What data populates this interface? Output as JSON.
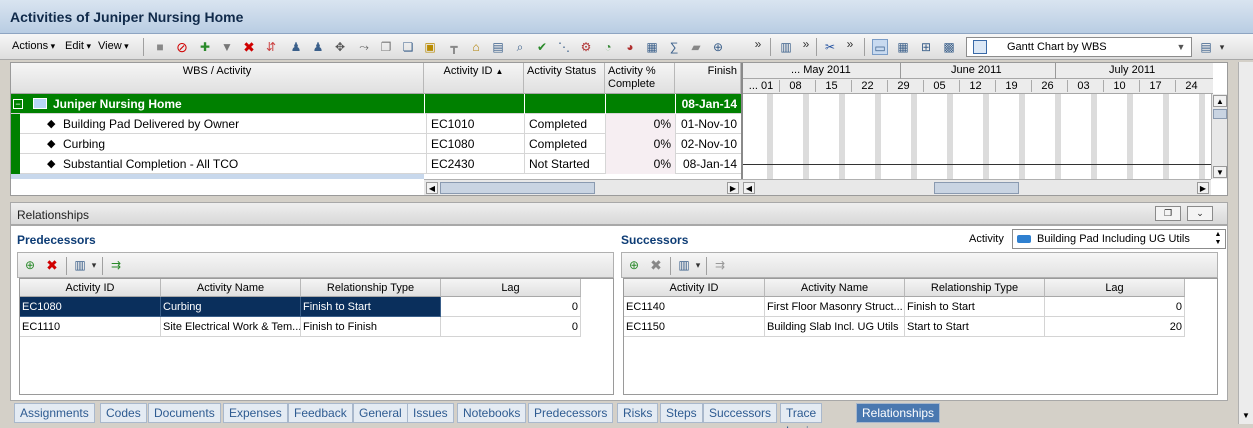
{
  "window": {
    "title": "Activities of Juniper Nursing Home"
  },
  "toolbar": {
    "menus": [
      "Actions",
      "Edit",
      "View"
    ],
    "layout_name": "Gantt Chart by WBS",
    "overflow": "»"
  },
  "grid": {
    "columns": [
      "WBS / Activity",
      "Activity ID",
      "Activity Status",
      "Activity % Complete",
      "Finish"
    ],
    "sort_indicator": "▲",
    "wbs_row": {
      "name": "Juniper Nursing Home",
      "finish": "08-Jan-14",
      "toggle": "−"
    },
    "rows": [
      {
        "name": "Building Pad Delivered by Owner",
        "id": "EC1010",
        "status": "Completed",
        "pct": "0%",
        "finish": "01-Nov-10"
      },
      {
        "name": "Curbing",
        "id": "EC1080",
        "status": "Completed",
        "pct": "0%",
        "finish": "02-Nov-10"
      },
      {
        "name": "Substantial Completion - All TCO",
        "id": "EC2430",
        "status": "Not Started",
        "pct": "0%",
        "finish": "08-Jan-14"
      }
    ]
  },
  "gantt": {
    "months": [
      "... May 2011",
      "June 2011",
      "July 2011"
    ],
    "days": [
      "... 01",
      "08",
      "15",
      "22",
      "29",
      "05",
      "12",
      "19",
      "26",
      "03",
      "10",
      "17",
      "24"
    ]
  },
  "relationships": {
    "title": "Relationships",
    "predecessors": {
      "label": "Predecessors",
      "columns": [
        "Activity ID",
        "Activity Name",
        "Relationship Type",
        "Lag"
      ],
      "rows": [
        {
          "id": "EC1080",
          "name": "Curbing",
          "type": "Finish to Start",
          "lag": "0"
        },
        {
          "id": "EC1110",
          "name": "Site Electrical Work & Tem...",
          "type": "Finish to Finish",
          "lag": "0"
        }
      ]
    },
    "successors": {
      "label": "Successors",
      "activity_label": "Activity",
      "activity_value": "Building Pad Including UG Utils",
      "columns": [
        "Activity ID",
        "Activity Name",
        "Relationship Type",
        "Lag"
      ],
      "rows": [
        {
          "id": "EC1140",
          "name": "First Floor Masonry Struct...",
          "type": "Finish to Start",
          "lag": "0"
        },
        {
          "id": "EC1150",
          "name": "Building Slab Incl. UG Utils",
          "type": "Start to Start",
          "lag": "20"
        }
      ]
    }
  },
  "tabs": [
    "Assignments",
    "Codes",
    "Documents",
    "Expenses",
    "Feedback",
    "General",
    "Issues",
    "Notebooks",
    "Predecessors",
    "Risks",
    "Steps",
    "Successors",
    "Trace Logic",
    "Relationships"
  ],
  "active_tab": "Relationships",
  "colors": {
    "wbs_green": "#008000",
    "selected_row": "#0a2f5c",
    "tab_active": "#4a78b0"
  }
}
